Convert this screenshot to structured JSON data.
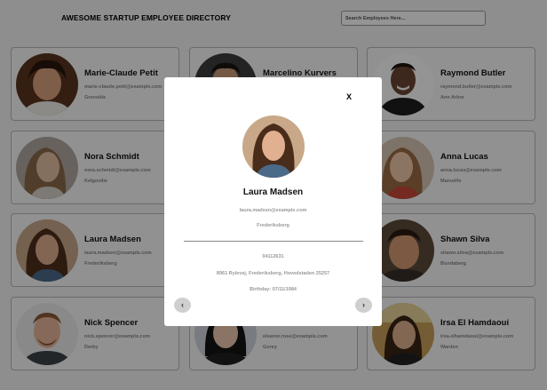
{
  "header": {
    "title": "AWESOME STARTUP EMPLOYEE DIRECTORY",
    "search_placeholder": "Search Employees Here..."
  },
  "employees": [
    {
      "name": "Marie-Claude Petit",
      "email": "marie-claude.petit@example.com",
      "city": "Grenoble"
    },
    {
      "name": "Marcelino Kurvers",
      "email": "",
      "city": ""
    },
    {
      "name": "Raymond Butler",
      "email": "raymond.butler@example.com",
      "city": "Ann Arbor"
    },
    {
      "name": "Nora Schmidt",
      "email": "nora.schmidt@example.com",
      "city": "Kelgoville"
    },
    {
      "name": "",
      "email": "",
      "city": ""
    },
    {
      "name": "Anna Lucas",
      "email": "anna.lucas@example.com",
      "city": "Marseille"
    },
    {
      "name": "Laura Madsen",
      "email": "laura.madsen@example.com",
      "city": "Frederiksberg"
    },
    {
      "name": "",
      "email": "",
      "city": ""
    },
    {
      "name": "Shawn Silva",
      "email": "shawn.silva@example.com",
      "city": "Bundaberg"
    },
    {
      "name": "Nick Spencer",
      "email": "nick.spencer@example.com",
      "city": "Derby"
    },
    {
      "name": "",
      "email": "eleanor.rose@example.com",
      "city": "Gorey"
    },
    {
      "name": "Irsa El Hamdaoui",
      "email": "irsa.elhamdaoui@example.com",
      "city": "Warden"
    }
  ],
  "modal": {
    "close_label": "X",
    "name": "Laura Madsen",
    "email": "laura.madsen@example.com",
    "city": "Frederiksberg",
    "phone": "04112631",
    "address": "8961 Rylevej, Frederiksberg, Hovedstaden 25257",
    "birthday": "Birthday: 07/11/1984",
    "prev_label": "‹",
    "next_label": "›"
  }
}
